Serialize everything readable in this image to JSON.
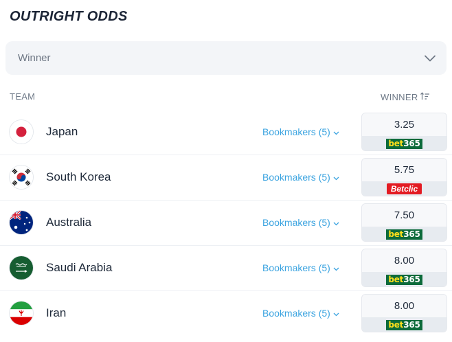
{
  "header": {
    "title": "OUTRIGHT ODDS"
  },
  "market_select": {
    "value": "Winner",
    "icon": "chevron-down-icon"
  },
  "table": {
    "col_team": "TEAM",
    "col_winner": "WINNER",
    "rows": [
      {
        "team": "Japan",
        "flag": "japan-flag",
        "bookmakers": "Bookmakers (5)",
        "odds": "3.25",
        "bookmaker": "bet365"
      },
      {
        "team": "South Korea",
        "flag": "south-korea-flag",
        "bookmakers": "Bookmakers (5)",
        "odds": "5.75",
        "bookmaker": "Betclic"
      },
      {
        "team": "Australia",
        "flag": "australia-flag",
        "bookmakers": "Bookmakers (5)",
        "odds": "7.50",
        "bookmaker": "bet365"
      },
      {
        "team": "Saudi Arabia",
        "flag": "saudi-arabia-flag",
        "bookmakers": "Bookmakers (5)",
        "odds": "8.00",
        "bookmaker": "bet365"
      },
      {
        "team": "Iran",
        "flag": "iran-flag",
        "bookmakers": "Bookmakers (5)",
        "odds": "8.00",
        "bookmaker": "bet365"
      }
    ]
  },
  "colors": {
    "link": "#3aa3e0",
    "bet365_green": "#0d6b3b",
    "bet365_yellow": "#ffdf1b",
    "betclic_red": "#e31b23"
  }
}
